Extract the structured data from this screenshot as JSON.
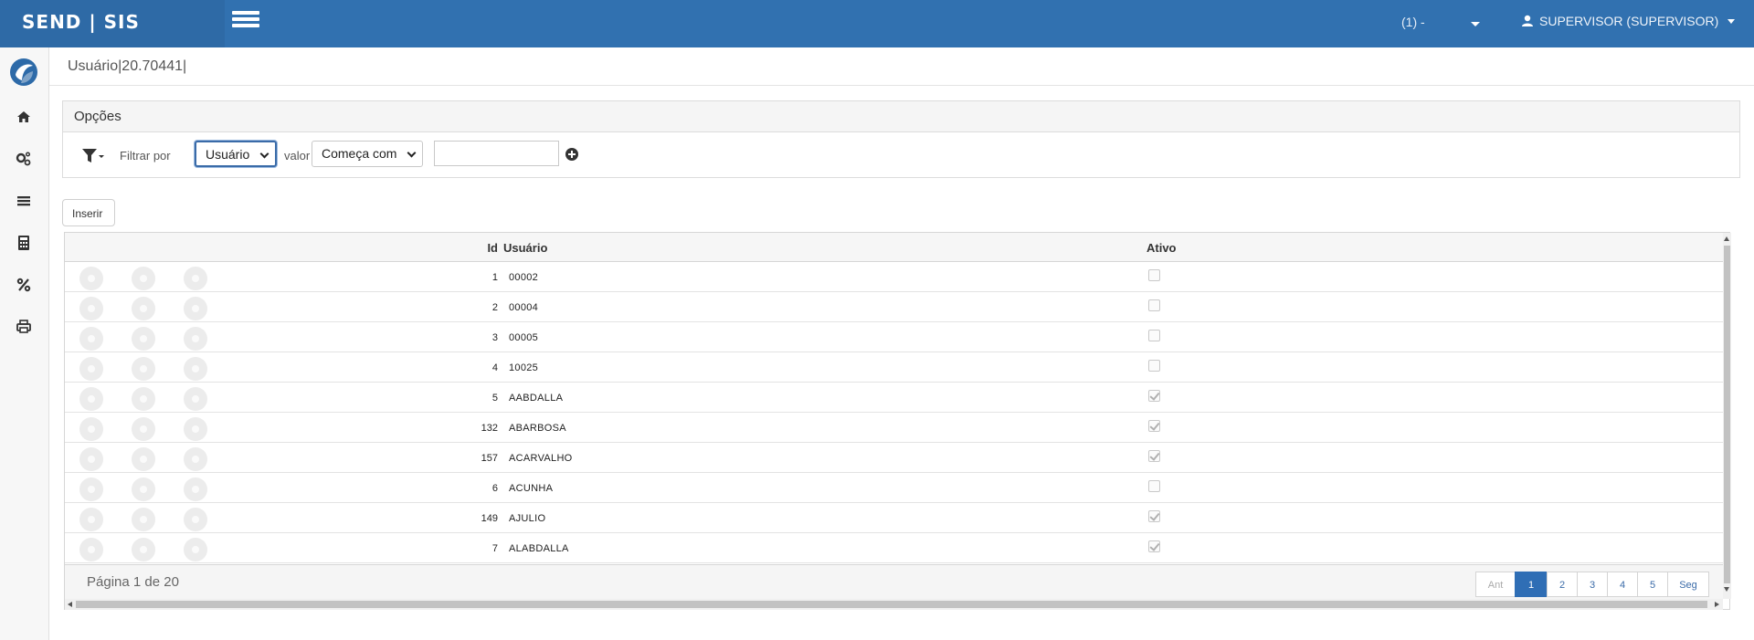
{
  "app": {
    "brand": "SEND | SIS"
  },
  "header": {
    "company": "(1) -",
    "user": "SUPERVISOR (SUPERVISOR)",
    "icons": [
      "menu-icon",
      "user-icon"
    ]
  },
  "sidebar": {
    "items": [
      "home-icon",
      "gears-icon",
      "list-icon",
      "calculator-icon",
      "percent-icon",
      "print-icon"
    ]
  },
  "breadcrumb": {
    "text": "Usuário|20.70441|"
  },
  "options": {
    "title": "Opções",
    "filter_label": "Filtrar por",
    "filter_field": "Usuário",
    "value_label": "valor",
    "operator": "Começa com",
    "value": ""
  },
  "toolbar": {
    "insert_label": "Inserir"
  },
  "grid": {
    "columns": [
      "Id",
      "Usuário",
      "Ativo"
    ],
    "rows": [
      {
        "id": "1",
        "user": "00002",
        "ativo": false
      },
      {
        "id": "2",
        "user": "00004",
        "ativo": false
      },
      {
        "id": "3",
        "user": "00005",
        "ativo": false
      },
      {
        "id": "4",
        "user": "10025",
        "ativo": false
      },
      {
        "id": "5",
        "user": "AABDALLA",
        "ativo": true
      },
      {
        "id": "132",
        "user": "ABARBOSA",
        "ativo": true
      },
      {
        "id": "157",
        "user": "ACARVALHO",
        "ativo": true
      },
      {
        "id": "6",
        "user": "ACUNHA",
        "ativo": false
      },
      {
        "id": "149",
        "user": "AJULIO",
        "ativo": true
      },
      {
        "id": "7",
        "user": "ALABDALLA",
        "ativo": true
      }
    ],
    "page_info": "Página 1 de 20",
    "pager": {
      "prev": "Ant",
      "pages": [
        "1",
        "2",
        "3",
        "4",
        "5"
      ],
      "next": "Seg",
      "current": "1"
    }
  },
  "colors": {
    "topbar": "#3171b0",
    "brand_bg": "#2e6aa6",
    "accent": "#2f6eb5"
  }
}
